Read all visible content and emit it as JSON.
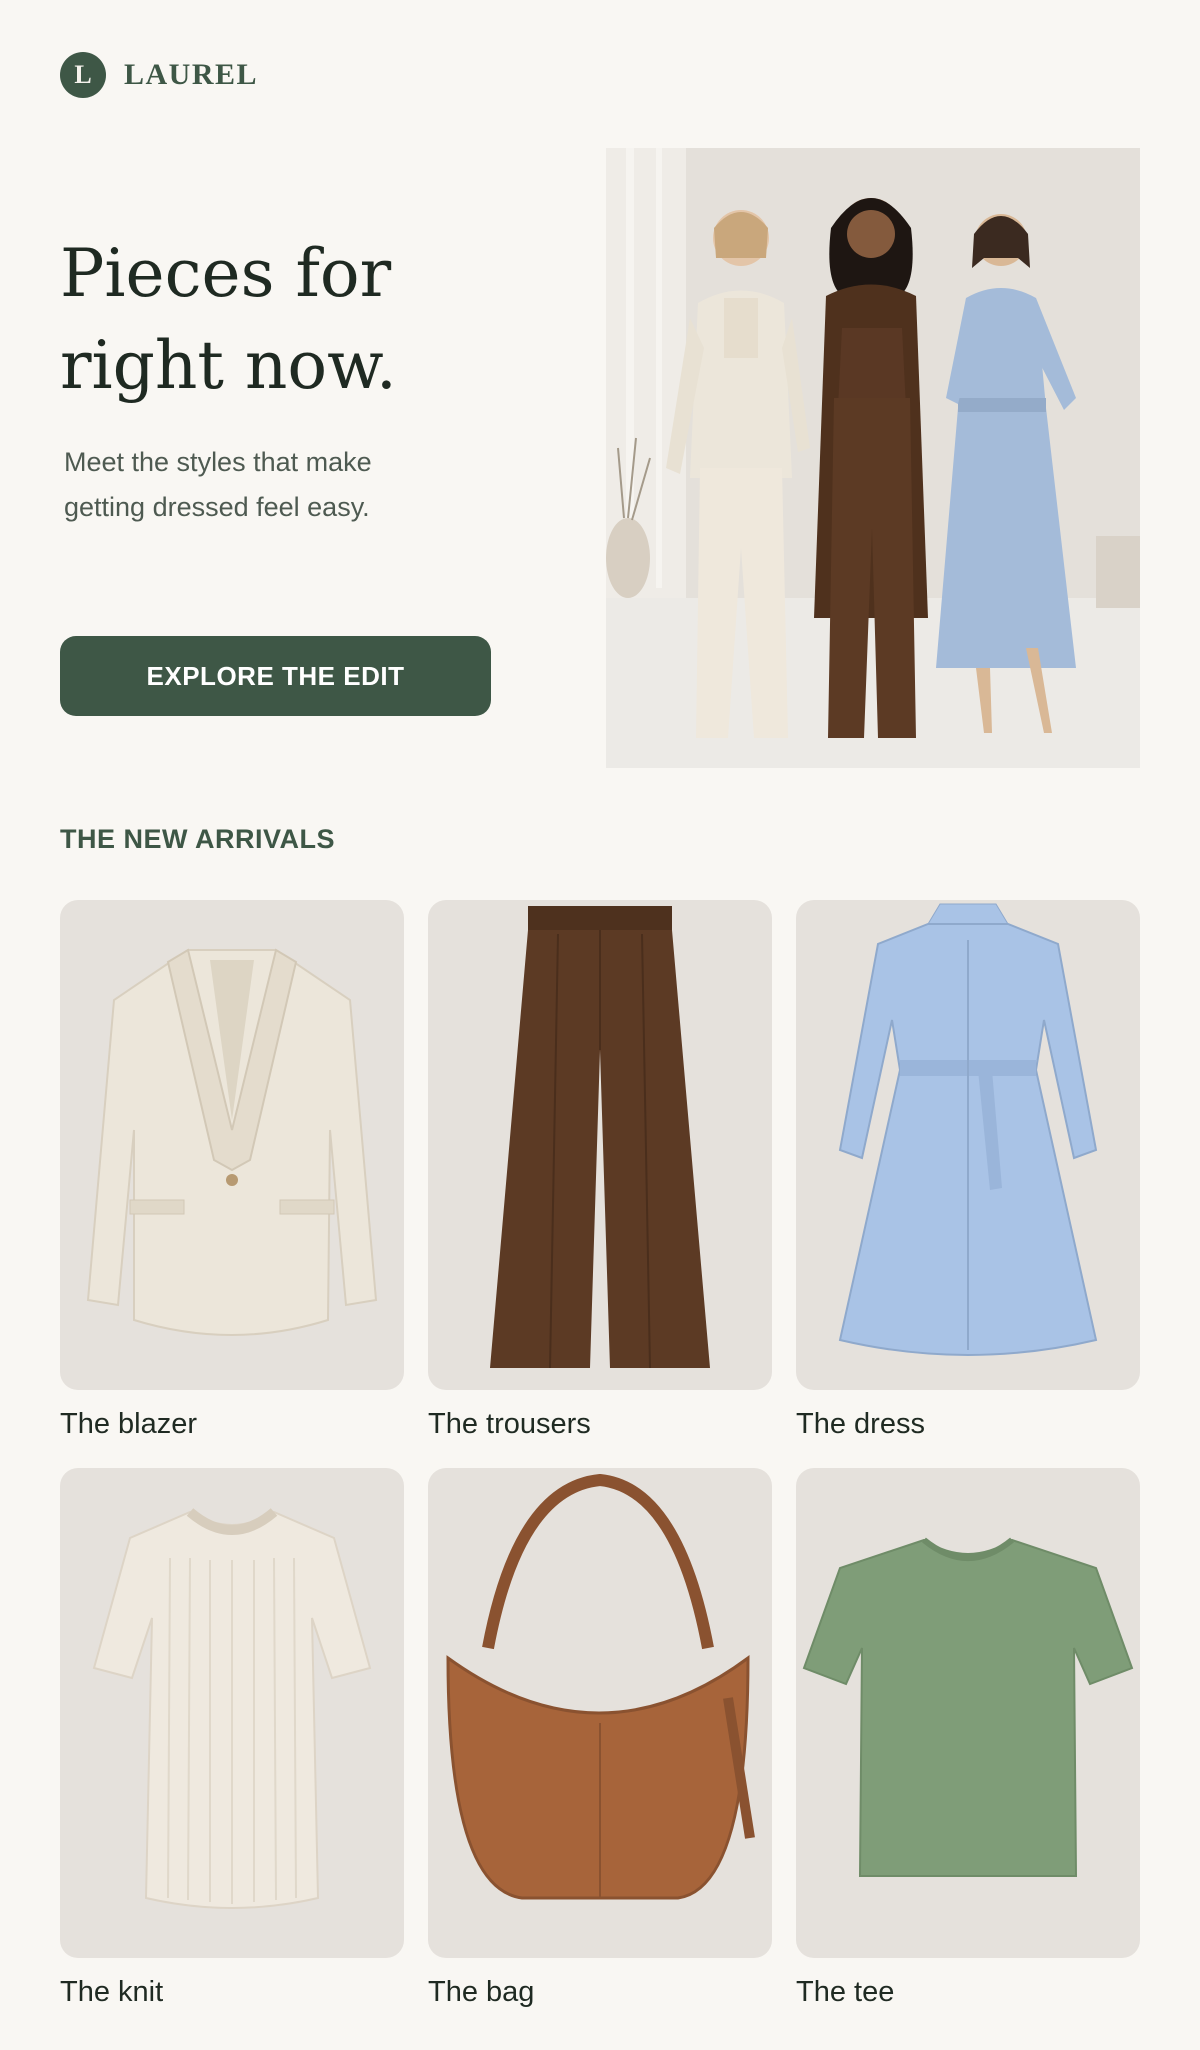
{
  "brand": {
    "logo_letter": "L",
    "name": "LAUREL"
  },
  "hero": {
    "title_line1": "Pieces for",
    "title_line2": "right now.",
    "subtitle_line1": "Meet the styles that make",
    "subtitle_line2": "getting dressed feel easy.",
    "cta_label": "EXPLORE THE EDIT"
  },
  "arrivals": {
    "heading": "THE NEW ARRIVALS",
    "items": [
      {
        "label": "The blazer",
        "icon": "blazer-icon",
        "color": "#ece6da"
      },
      {
        "label": "The trousers",
        "icon": "trousers-icon",
        "color": "#5c3a24"
      },
      {
        "label": "The dress",
        "icon": "dress-icon",
        "color": "#a9c3e6"
      },
      {
        "label": "The knit",
        "icon": "knit-icon",
        "color": "#efe9df"
      },
      {
        "label": "The bag",
        "icon": "bag-icon",
        "color": "#a7643a"
      },
      {
        "label": "The tee",
        "icon": "tee-icon",
        "color": "#7f9d78"
      }
    ]
  },
  "colors": {
    "brand_green": "#3e5746",
    "background": "#f9f7f3",
    "card_bg": "#e5e1dc"
  }
}
